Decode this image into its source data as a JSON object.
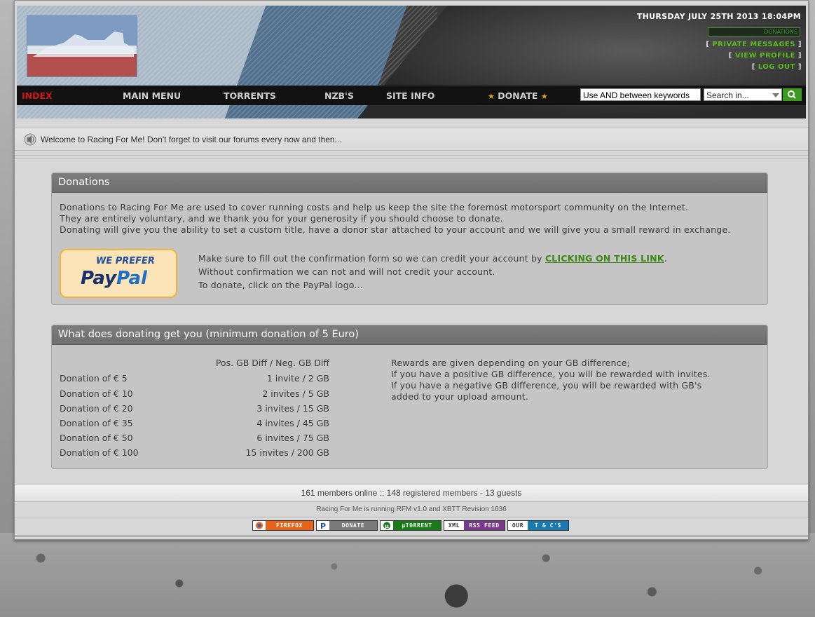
{
  "header": {
    "date": "THURSDAY JULY 25TH 2013 18:04PM",
    "donations_box": "DONATIONS",
    "links": [
      "PRIVATE MESSAGES",
      "VIEW PROFILE",
      "LOG OUT"
    ]
  },
  "nav": {
    "items": [
      "INDEX",
      "MAIN MENU",
      "TORRENTS",
      "NZB'S",
      "SITE INFO",
      "DONATE"
    ],
    "active": "INDEX"
  },
  "search": {
    "value": "Use AND between keywords",
    "select": "Search in..."
  },
  "welcome": "Welcome to Racing For Me! Don't forget to visit our forums every now and then...",
  "donations": {
    "title": "Donations",
    "lines": [
      "Donations to Racing For Me are used to cover running costs and help us keep the site the foremost motorsport community on the Internet.",
      "They are entirely voluntary, and we thank you for your generosity if you should choose to donate.",
      "Donating will give you the ability to set a custom title, have a donor star attached to your account and we will give you a small reward in exchange."
    ],
    "paypal_top": "WE PREFER",
    "paypal_pay": "Pay",
    "paypal_pal": "Pal",
    "confirm_prefix": "Make sure to fill out the confirmation form so we can credit your account by ",
    "confirm_link": "CLICKING ON THIS LINK",
    "confirm_suffix": ".",
    "without": "Without confirmation we can not and will not credit your account.",
    "to_donate": "To donate, click on the PayPal logo..."
  },
  "rewards": {
    "title": "What does donating get you (minimum donation of 5 Euro)",
    "column_header": "Pos. GB Diff / Neg. GB Diff",
    "rows": [
      {
        "label": "Donation of € 5",
        "reward": "1 invite / 2 GB"
      },
      {
        "label": "Donation of € 10",
        "reward": "2 invites / 5 GB"
      },
      {
        "label": "Donation of € 20",
        "reward": "3 invites / 15 GB"
      },
      {
        "label": "Donation of € 35",
        "reward": "4 invites / 45 GB"
      },
      {
        "label": "Donation of € 50",
        "reward": "6 invites / 75 GB"
      },
      {
        "label": "Donation of € 100",
        "reward": "15 invites / 200 GB"
      }
    ],
    "explanation": [
      "Rewards are given depending on your GB difference;",
      "If you have a positive GB difference, you will be rewarded with invites.",
      "If you have a negative GB difference, you will be rewarded with GB's",
      "added to your upload amount."
    ]
  },
  "footer": {
    "online": "161 members online :: 148 registered members - 13 guests",
    "running": "Racing For Me is running RFM v1.0 and XBTT Revision 1636",
    "badges": [
      {
        "label": "FIREFOX",
        "color": "#e8631a",
        "icon": "firefox-icon"
      },
      {
        "label": "DONATE",
        "color": "#7a7a7a",
        "icon": "paypal-icon"
      },
      {
        "label": "µTORRENT",
        "color": "#1a7a1a",
        "icon": "utorrent-icon"
      },
      {
        "label": "RSS FEED",
        "color": "#7a3a8a",
        "icon": "rss-icon",
        "prefix": "XML"
      },
      {
        "label": "T & C'S",
        "color": "#1a7ab0",
        "icon": "terms-icon",
        "prefix": "OUR"
      }
    ]
  }
}
